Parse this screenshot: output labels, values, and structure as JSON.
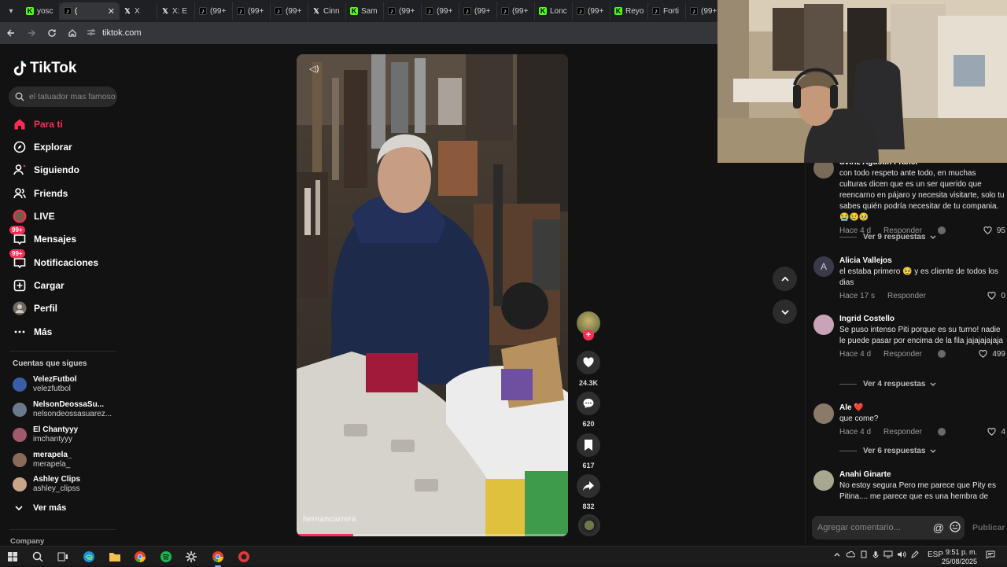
{
  "browser": {
    "tabs": [
      {
        "icon": "kick-icon",
        "title": "yosc",
        "active": false
      },
      {
        "icon": "tiktok-icon",
        "title": "(",
        "active": true
      },
      {
        "icon": "x-icon",
        "title": "X",
        "active": false
      },
      {
        "icon": "x-icon",
        "title": "X: E",
        "active": false
      },
      {
        "icon": "tiktok-icon",
        "title": "(99+",
        "active": false
      },
      {
        "icon": "tiktok-icon",
        "title": "(99+",
        "active": false
      },
      {
        "icon": "tiktok-icon",
        "title": "(99+",
        "active": false
      },
      {
        "icon": "x-icon",
        "title": "Cinn",
        "active": false
      },
      {
        "icon": "kick-icon",
        "title": "Sam",
        "active": false
      },
      {
        "icon": "tiktok-icon",
        "title": "(99+",
        "active": false
      },
      {
        "icon": "tiktok-icon",
        "title": "(99+",
        "active": false
      },
      {
        "icon": "tiktok-icon",
        "title": "(99+",
        "active": false
      },
      {
        "icon": "tiktok-icon",
        "title": "(99+",
        "active": false
      },
      {
        "icon": "kick-icon",
        "title": "Lonc",
        "active": false
      },
      {
        "icon": "tiktok-icon",
        "title": "(99+",
        "active": false
      },
      {
        "icon": "kick-icon",
        "title": "Reyo",
        "active": false
      },
      {
        "icon": "tiktok-icon",
        "title": "Forti",
        "active": false
      },
      {
        "icon": "tiktok-icon",
        "title": "(99+",
        "active": false
      }
    ],
    "close_glyph": "✕",
    "url": "tiktok.com"
  },
  "sidebar": {
    "logo_text": "TikTok",
    "search_placeholder": "el tatuador mas famoso",
    "nav": [
      {
        "label": "Para ti",
        "icon": "home-icon",
        "active": true
      },
      {
        "label": "Explorar",
        "icon": "compass-icon",
        "active": false
      },
      {
        "label": "Siguiendo",
        "icon": "following-icon",
        "active": false
      },
      {
        "label": "Friends",
        "icon": "friends-icon",
        "active": false
      },
      {
        "label": "LIVE",
        "icon": "live-icon",
        "active": false
      },
      {
        "label": "Mensajes",
        "icon": "messages-icon",
        "badge": "99+",
        "active": false
      },
      {
        "label": "Notificaciones",
        "icon": "notifications-icon",
        "badge": "99+",
        "active": false
      },
      {
        "label": "Cargar",
        "icon": "upload-icon",
        "active": false
      },
      {
        "label": "Perfil",
        "icon": "profile-avatar-icon",
        "active": false
      },
      {
        "label": "Más",
        "icon": "more-icon",
        "active": false
      }
    ],
    "following_title": "Cuentas que sigues",
    "accounts": [
      {
        "name": "VelezFutbol",
        "handle": "velezfutbol"
      },
      {
        "name": "NelsonDeossaSu...",
        "handle": "nelsondeossasuarez..."
      },
      {
        "name": "El Chantyyy",
        "handle": "imchantyyy"
      },
      {
        "name": "merapela_",
        "handle": "merapela_"
      },
      {
        "name": "Ashley Clips",
        "handle": "ashley_clipss"
      }
    ],
    "see_more": "Ver más",
    "company": "Company"
  },
  "video": {
    "username": "hernancarrera",
    "progress": 0.21,
    "likes": "24.3K",
    "comments": "620",
    "saves": "617",
    "shares": "832"
  },
  "comments": [
    {
      "name": "Sviriz Agustin Franci",
      "avatar": "#7a6a5a",
      "text": "con todo respeto ante todo, en muchas culturas dicen que es un ser querido que reencarno en pájaro y necesita visitarte, solo tu sabes quién podría necesitar de tu compania. 😭😢🥹",
      "time": "Hace 4 d",
      "reply": "Responder",
      "likes": "95",
      "replies": "Ver 9 respuestas"
    },
    {
      "name": "Alicia Vallejos",
      "avatar": "#3a3a4a",
      "initial": "A",
      "text": "el estaba primero 🥹 y es cliente de todos los dias",
      "time": "Hace 17 s",
      "reply": "Responder",
      "likes": "0"
    },
    {
      "name": "Ingrid Costello",
      "avatar": "#c9a4b8",
      "text": "Se puso intenso Piti porque es su turno! nadie le puede pasar por encima de la fila jajajajajaja",
      "time": "Hace 4 d",
      "reply": "Responder",
      "likes": "499",
      "replies": "Ver 4 respuestas"
    },
    {
      "name": "Ale",
      "heart": "❤️",
      "avatar": "#8b7a6a",
      "text": "que come?",
      "time": "Hace 4 d",
      "reply": "Responder",
      "likes": "4",
      "replies": "Ver 6 respuestas"
    },
    {
      "name": "Anahi Ginarte",
      "avatar": "#a8a890",
      "text": "No estoy segura Pero me parece que Pity es Pitina.... me parece que es una hembra de"
    }
  ],
  "comment_input": {
    "placeholder": "Agregar comentario...",
    "at": "@",
    "publish": "Publicar"
  },
  "taskbar": {
    "lang": "ESP",
    "time": "9:51 p. m.",
    "date": "25/08/2025"
  },
  "colors": {
    "accent": "#fe2c55",
    "background": "#121212"
  }
}
